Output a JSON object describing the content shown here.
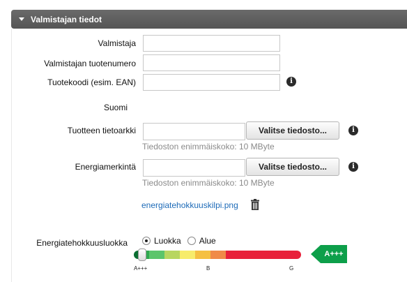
{
  "section": {
    "title": "Valmistajan tiedot"
  },
  "fields": {
    "manufacturer": {
      "label": "Valmistaja",
      "value": ""
    },
    "manufacturer_product_number": {
      "label": "Valmistajan tuotenumero",
      "value": ""
    },
    "product_code": {
      "label": "Tuotekoodi (esim. EAN)",
      "value": ""
    }
  },
  "language_heading": "Suomi",
  "datasheet": {
    "label": "Tuotteen tietoarkki",
    "value": "",
    "button": "Valitse tiedosto...",
    "hint": "Tiedoston enimmäiskoko: 10 MByte"
  },
  "energy_label": {
    "label": "Energiamerkintä",
    "value": "",
    "button": "Valitse tiedosto...",
    "hint": "Tiedoston enimmäiskoko: 10 MByte",
    "file_name": "energiatehokkuuskilpi.png"
  },
  "energy_class": {
    "label": "Energiatehokkuusluokka",
    "options": [
      "Luokka",
      "Alue"
    ],
    "selected": "Luokka",
    "scale_ticks": [
      "A+++",
      "B",
      "G"
    ],
    "current": "A+++",
    "badge_color": "#0d9f4a",
    "segment_colors": [
      "#0a6e32",
      "#2fa84f",
      "#5cc56b",
      "#b8d660",
      "#f7ec6b",
      "#f5c042",
      "#f08a48",
      "#e8203a",
      "#e8203a",
      "#e8203a"
    ]
  }
}
